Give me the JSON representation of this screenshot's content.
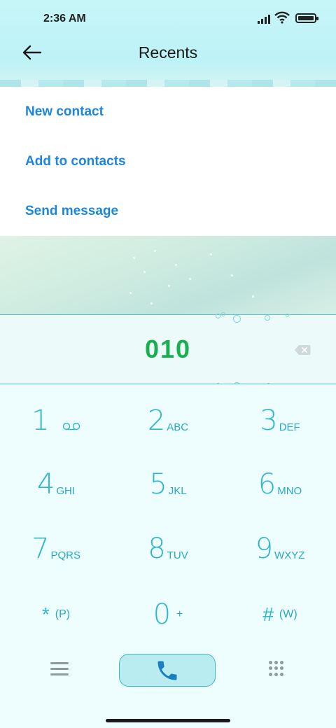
{
  "status_bar": {
    "time": "2:36 AM"
  },
  "header": {
    "title": "Recents"
  },
  "menu": {
    "items": [
      {
        "label": "New contact"
      },
      {
        "label": "Add to contacts"
      },
      {
        "label": "Send message"
      }
    ]
  },
  "display": {
    "number": "010"
  },
  "keypad": {
    "keys": [
      {
        "digit": "1",
        "letters": ""
      },
      {
        "digit": "2",
        "letters": "ABC"
      },
      {
        "digit": "3",
        "letters": "DEF"
      },
      {
        "digit": "4",
        "letters": "GHI"
      },
      {
        "digit": "5",
        "letters": "JKL"
      },
      {
        "digit": "6",
        "letters": "MNO"
      },
      {
        "digit": "7",
        "letters": "PQRS"
      },
      {
        "digit": "8",
        "letters": "TUV"
      },
      {
        "digit": "9",
        "letters": "WXYZ"
      },
      {
        "digit": "*",
        "letters": "(P)"
      },
      {
        "digit": "0",
        "letters": "+"
      },
      {
        "digit": "#",
        "letters": "(W)"
      }
    ]
  },
  "colors": {
    "accent_blue": "#1c86de",
    "number_green": "#17b04f",
    "keypad_teal": "#30b8c9"
  },
  "icons": {
    "back": "arrow-left-icon",
    "backspace": "backspace-icon",
    "menu": "hamburger-icon",
    "call": "phone-icon",
    "dialpad": "dialpad-grid-icon",
    "voicemail": "voicemail-icon"
  }
}
